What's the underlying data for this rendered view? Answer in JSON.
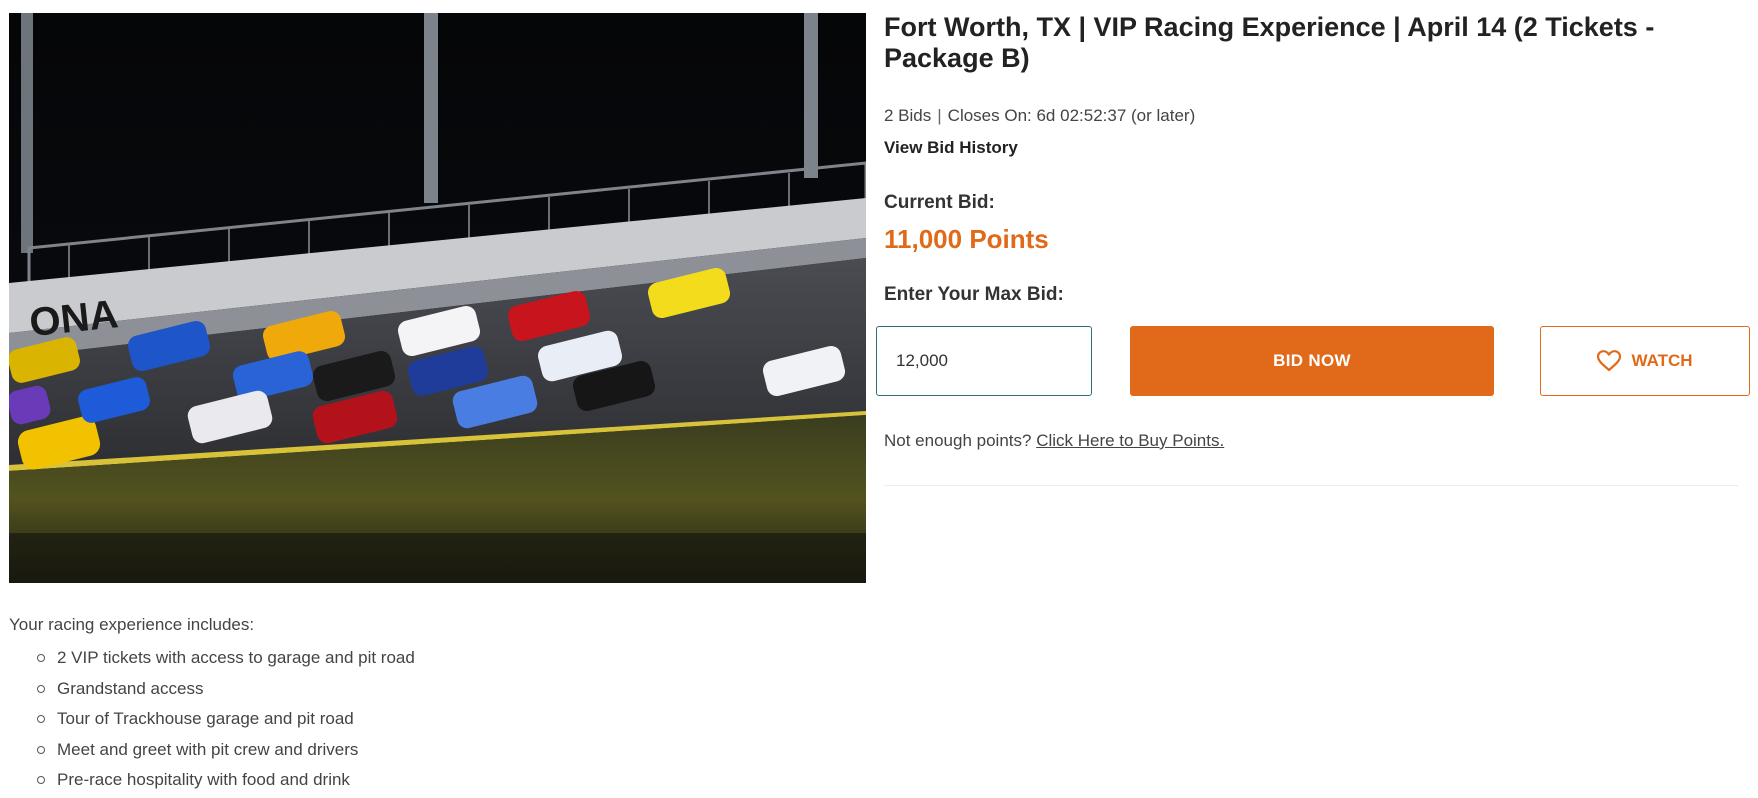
{
  "listing": {
    "title": "Fort Worth, TX | VIP Racing Experience | April 14 (2 Tickets - Package B)",
    "bids": "2 Bids",
    "closes": "Closes On: 6d 02:52:37 (or later)",
    "view_history": "View Bid History"
  },
  "bid": {
    "current_label": "Current Bid:",
    "current_value": "11,000 Points",
    "max_label": "Enter Your Max Bid:",
    "max_value": "12,000",
    "bid_button": "BID NOW",
    "watch_button": "WATCH",
    "not_enough": "Not enough points?",
    "buy_link": "Click Here to Buy Points."
  },
  "description": {
    "intro": "Your racing experience includes:",
    "items": [
      "2 VIP tickets with access to garage and pit road",
      "Grandstand access",
      "Tour of Trackhouse garage and pit road",
      "Meet and greet with pit crew and drivers",
      "Pre-race hospitality with food and drink"
    ]
  },
  "hero": {
    "alt_icon": "race-cars-photo",
    "track_text": "ONA"
  },
  "colors": {
    "accent": "#e06a19",
    "input_border": "#2f6e73"
  }
}
